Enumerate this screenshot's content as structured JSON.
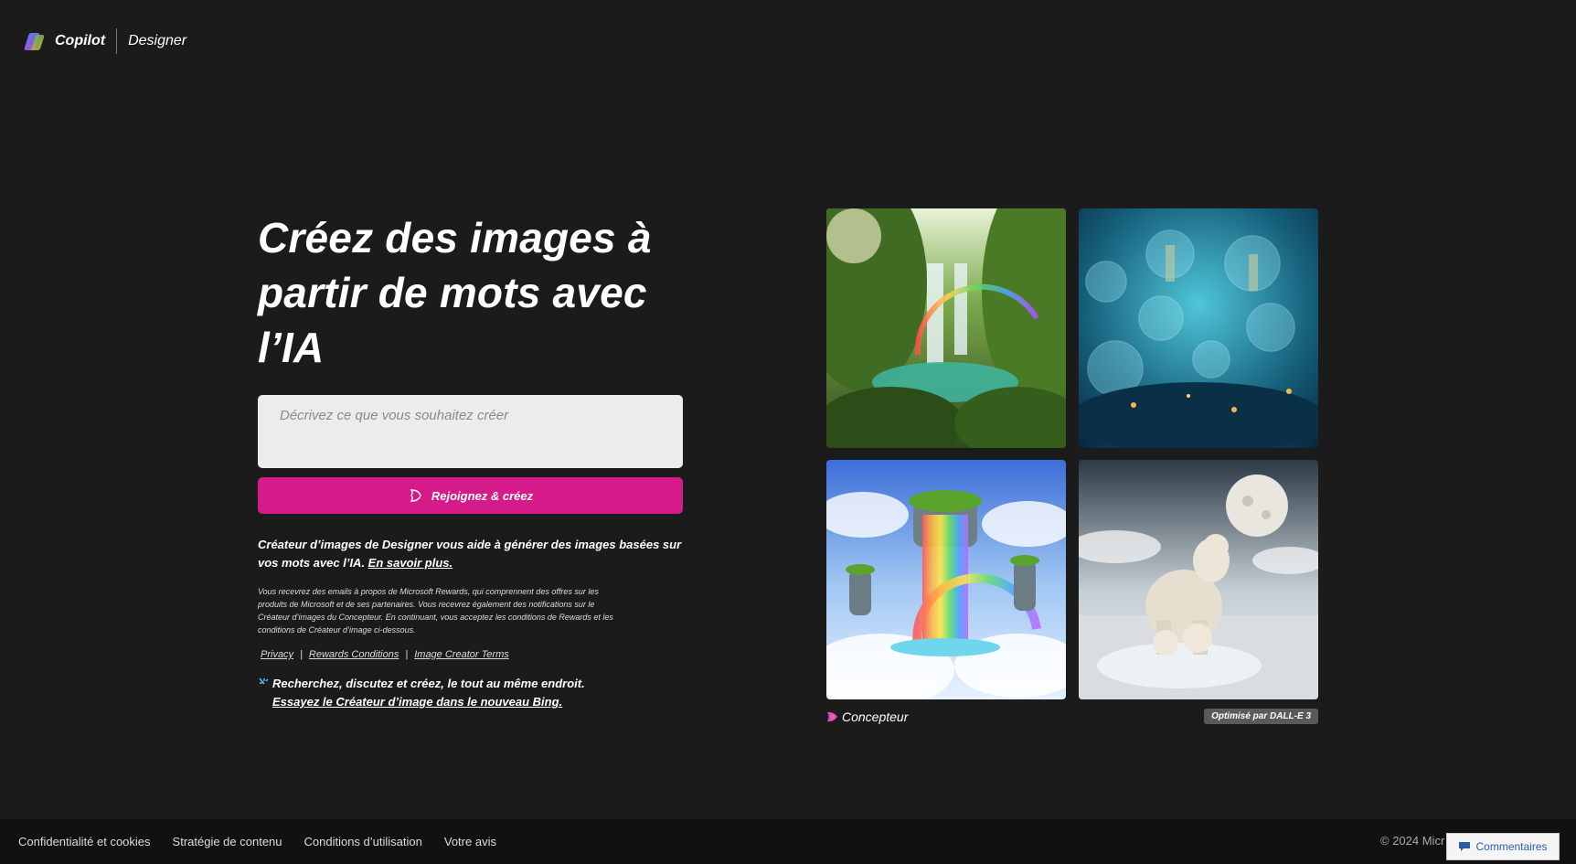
{
  "header": {
    "brand": "Copilot",
    "product": "Designer"
  },
  "hero": {
    "title_line1": "Créez des images à",
    "title_line2": "partir de mots avec",
    "title_line3": "l’IA"
  },
  "prompt": {
    "placeholder": "Décrivez ce que vous souhaitez créer"
  },
  "join_button": {
    "label": "Rejoignez & créez"
  },
  "description": {
    "text": "Créateur d’images de Designer vous aide à générer des images basées sur vos mots avec l’IA. ",
    "link": "En savoir plus."
  },
  "fine_print": "Vous recevrez des emails à propos de Microsoft Rewards, qui comprennent des offres sur les produits de Microsoft et de ses partenaires. Vous recevrez également des notifications sur le Créateur d’images du Concepteur. En continuant, vous acceptez les conditions de Rewards et les conditions de Créateur d’image ci-dessous.",
  "links": {
    "privacy": "Privacy",
    "rewards": "Rewards Conditions",
    "terms": "Image Creator Terms",
    "separator": "|"
  },
  "promo": {
    "line1": "Recherchez, discutez et créez, le tout au même endroit.",
    "link": "Essayez le Créateur d’image dans le nouveau Bing."
  },
  "gallery": {
    "tiles": [
      {
        "subject": "jungle waterfall with rainbow"
      },
      {
        "subject": "underwater city with glass domes"
      },
      {
        "subject": "floating islands rainbow waterfall"
      },
      {
        "subject": "polar bears under full moon"
      }
    ],
    "concepteur_label": "Concepteur",
    "badge": "Optimisé par DALL-E 3"
  },
  "footer": {
    "links": [
      "Confidentialité et cookies",
      "Stratégie de contenu",
      "Conditions d’utilisation",
      "Votre avis"
    ],
    "copyright": "© 2024 Micr",
    "feedback": "Commentaires"
  },
  "colors": {
    "background": "#1b1b1b",
    "accent": "#d51b8a",
    "footer_bg": "#111111"
  }
}
